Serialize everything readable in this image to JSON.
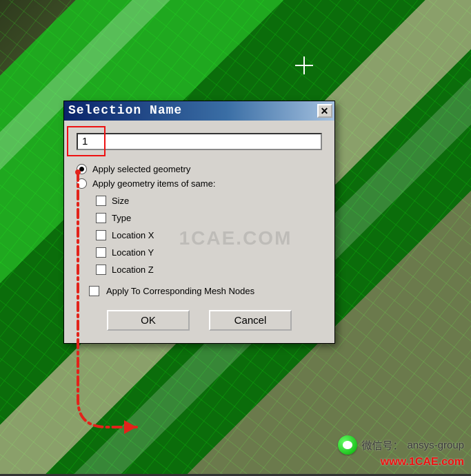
{
  "dialog": {
    "title": "Selection Name",
    "close_glyph": "✕",
    "input_value": "1",
    "radio_selected_label": "Apply selected geometry",
    "radio_same_label": "Apply geometry items of same:",
    "checks": {
      "size": "Size",
      "type": "Type",
      "loc_x": "Location X",
      "loc_y": "Location Y",
      "loc_z": "Location Z"
    },
    "apply_mesh_label": "Apply To Corresponding Mesh Nodes",
    "ok_label": "OK",
    "cancel_label": "Cancel"
  },
  "watermark_center": "1CAE.COM",
  "footer": {
    "wechat_prefix": "微信号：",
    "wechat_id": "ansys-group",
    "url": "www.1CAE.com"
  },
  "colors": {
    "annotation_red": "#e2231a",
    "title_gradient_start": "#0a246a",
    "title_gradient_end": "#a6c2e0",
    "dialog_bg": "#d6d3ce"
  }
}
